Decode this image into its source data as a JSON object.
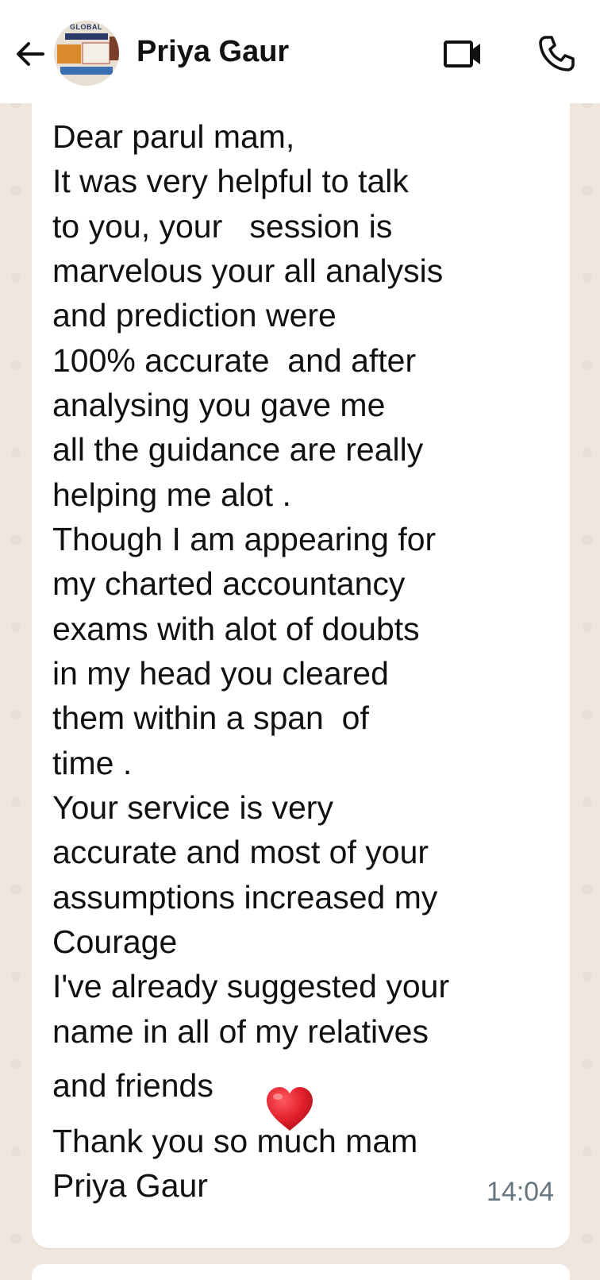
{
  "header": {
    "contact_name": "Priya Gaur",
    "avatar_text": "GLOBAL",
    "icons": [
      "back-arrow-icon",
      "video-call-icon",
      "phone-call-icon"
    ]
  },
  "message": {
    "lines": [
      "Dear parul mam,",
      "It was very helpful to talk",
      "to you, your   session is",
      "marvelous your all analysis",
      "and prediction were",
      "100% accurate  and after",
      "analysing you gave me",
      "all the guidance are really",
      "helping me alot .",
      "Though I am appearing for",
      "my charted accountancy",
      "exams with alot of doubts",
      "in my head you cleared",
      "them within a span  of",
      "time .",
      "Your service is very",
      "accurate and most of your",
      "assumptions increased my",
      "Courage",
      "I've already suggested your",
      "name in all of my relatives",
      "and friends",
      "Thank you so much mam",
      "Priya Gaur"
    ],
    "emoji": "heart-emoji",
    "time": "14:04"
  },
  "colors": {
    "header_bg": "#ffffff",
    "chat_bg": "#efe7dd",
    "bubble_bg": "#ffffff",
    "text": "#111111",
    "timestamp": "#667781",
    "heart": "#e0202a"
  }
}
